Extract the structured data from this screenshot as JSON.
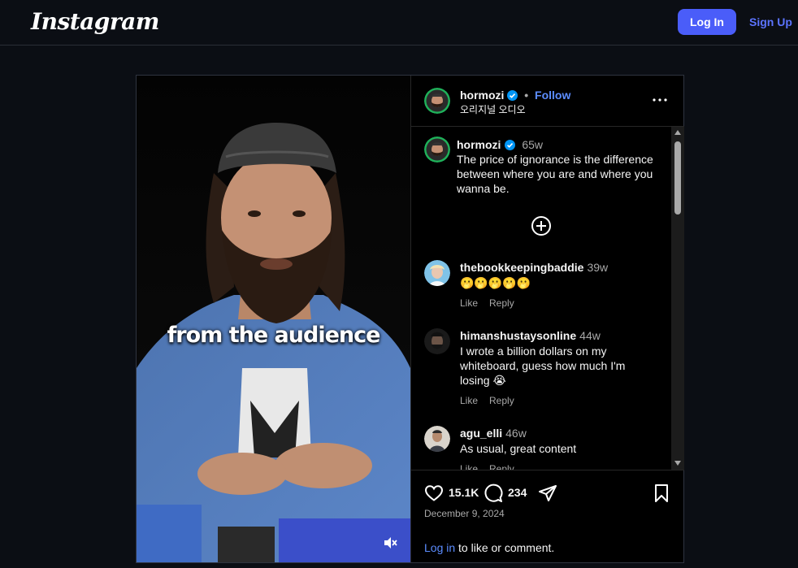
{
  "header": {
    "logo": "Instagram",
    "login_label": "Log In",
    "signup_label": "Sign Up"
  },
  "media": {
    "overlay_caption": "from the audience"
  },
  "post": {
    "username": "hormozi",
    "separator": "•",
    "follow_label": "Follow",
    "audio": "오리지널 오디오"
  },
  "caption": {
    "username": "hormozi",
    "time": "65w",
    "text": "The price of ignorance is the difference between where you are and where you wanna be."
  },
  "comments": [
    {
      "username": "thebookkeepingbaddie",
      "time": "39w",
      "text": "🫢🫢🫢🫢🫢",
      "like_label": "Like",
      "reply_label": "Reply"
    },
    {
      "username": "himanshustaysonline",
      "time": "44w",
      "text": "I wrote a billion dollars on my whiteboard, guess how much I'm losing 😭",
      "like_label": "Like",
      "reply_label": "Reply"
    },
    {
      "username": "agu_elli",
      "time": "46w",
      "text": "As usual, great content",
      "like_label": "Like",
      "reply_label": "Reply"
    }
  ],
  "footer": {
    "likes": "15.1K",
    "comments": "234",
    "date": "December 9, 2024",
    "login_link": "Log in",
    "login_suffix": " to like or comment."
  },
  "icons": {
    "verified": "verified-badge-icon",
    "more": "more-options-icon",
    "load_more": "plus-circle-icon",
    "like": "heart-icon",
    "comment": "comment-bubble-icon",
    "share": "paper-plane-icon",
    "save": "bookmark-icon",
    "mute": "speaker-muted-icon"
  },
  "colors": {
    "accent_button": "#4a5df9",
    "link_blue": "#5c8dff",
    "verified_blue": "#0095f6",
    "background": "#0b0e14"
  }
}
